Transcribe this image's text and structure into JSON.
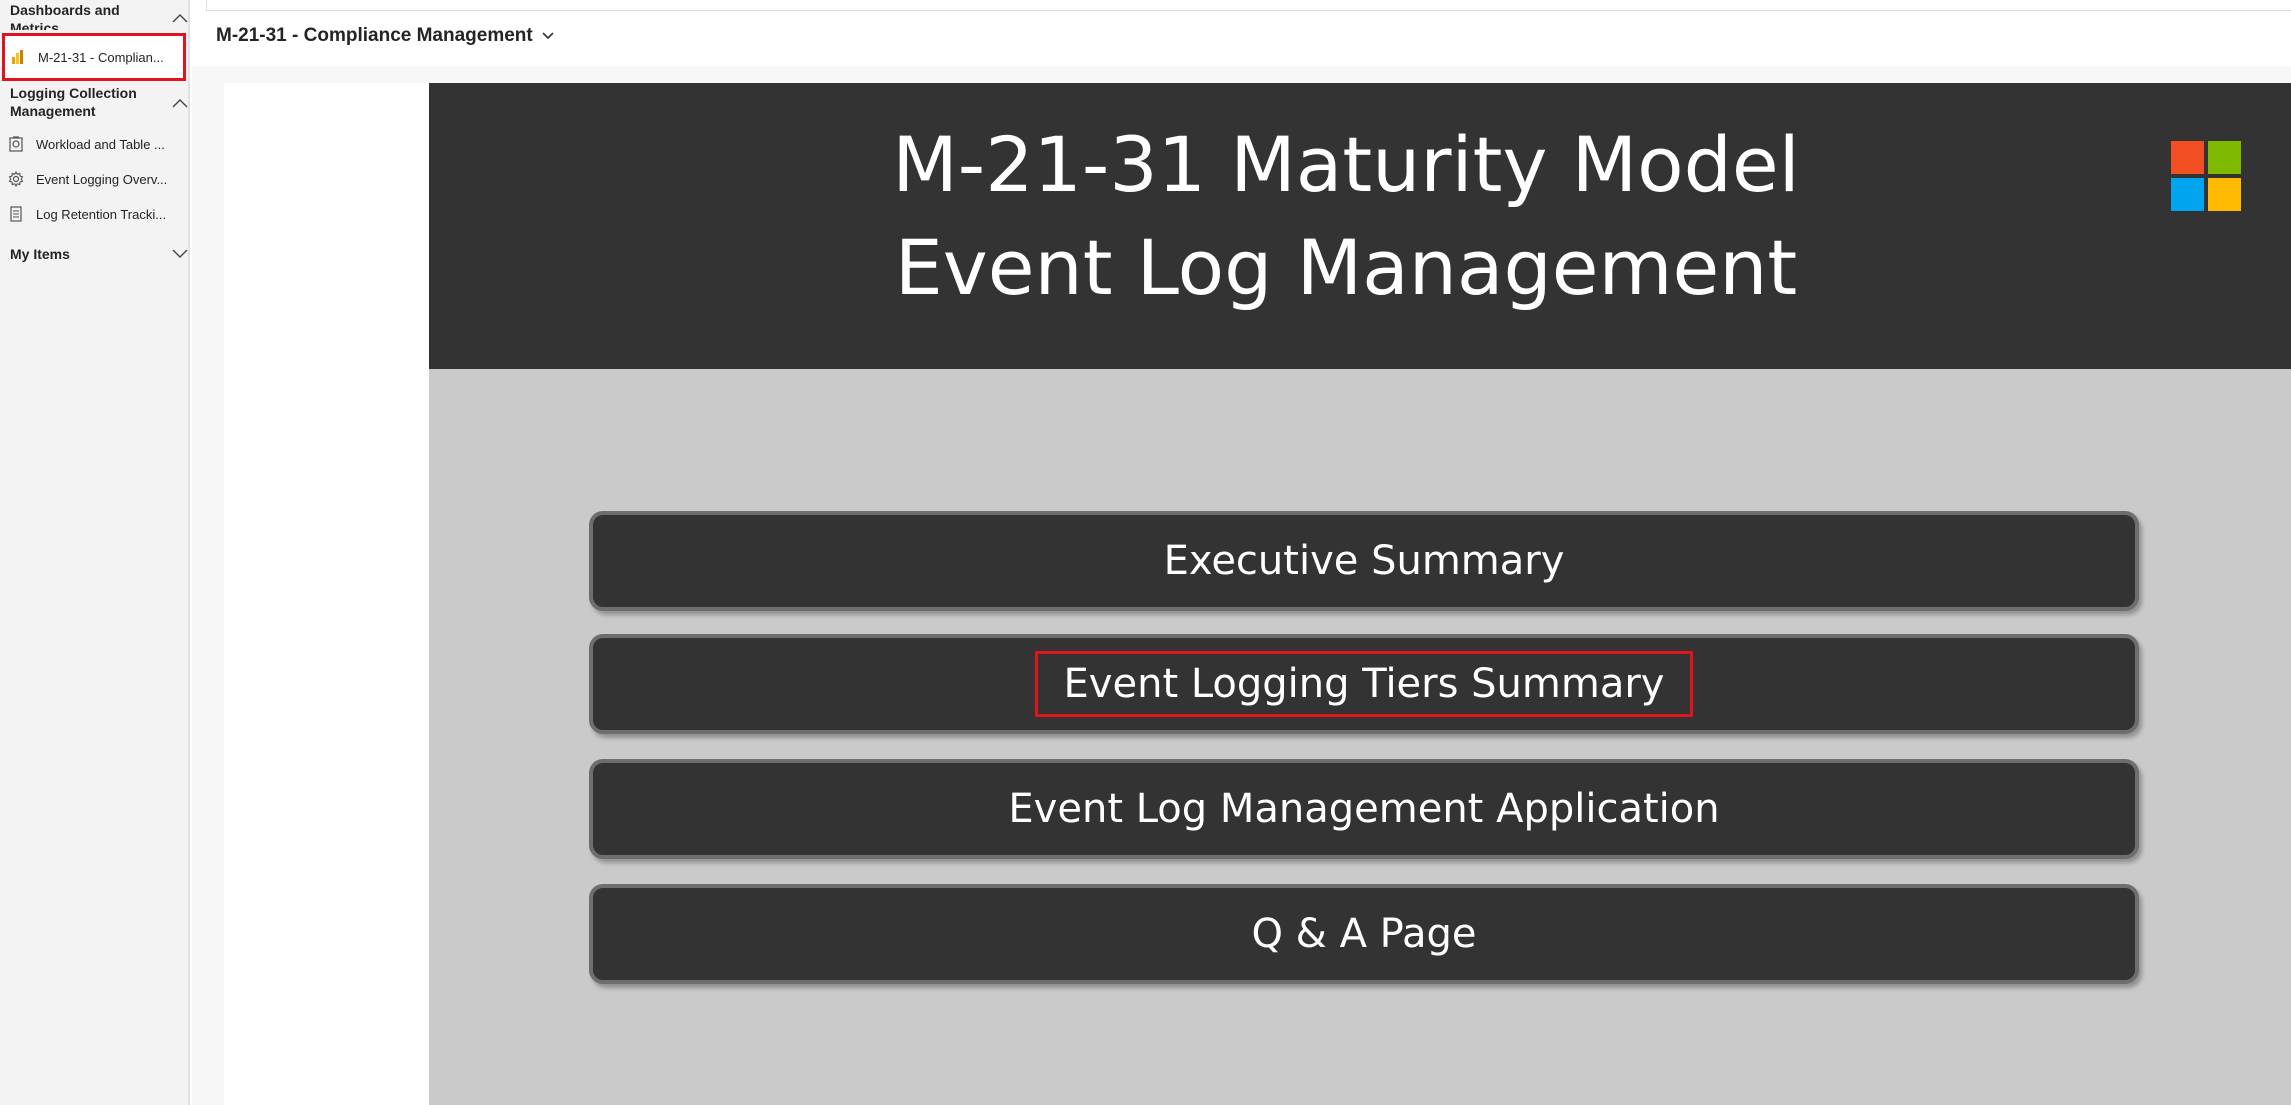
{
  "sidebar": {
    "sections": [
      {
        "title": "Dashboards and Metrics"
      },
      {
        "title": "Logging Collection Management"
      },
      {
        "title": "My Items"
      }
    ],
    "items": [
      {
        "label": "M-21-31 - Complian...",
        "icon": "report-icon"
      },
      {
        "label": "Workload and Table ...",
        "icon": "dataset-icon"
      },
      {
        "label": "Event Logging Overv...",
        "icon": "gear-icon"
      },
      {
        "label": "Log Retention Tracki...",
        "icon": "document-icon"
      }
    ]
  },
  "header": {
    "report_title": "M-21-31 - Compliance Management"
  },
  "report": {
    "title_line1": "M-21-31 Maturity Model",
    "title_line2": "Event Log Management",
    "buttons": [
      {
        "label": "Executive Summary"
      },
      {
        "label": "Event Logging Tiers Summary"
      },
      {
        "label": "Event Log Management Application"
      },
      {
        "label": "Q & A Page"
      }
    ],
    "logo": {
      "name": "microsoft-logo-icon",
      "colors": [
        "#f25022",
        "#7fba00",
        "#00a4ef",
        "#ffb900"
      ]
    }
  },
  "colors": {
    "highlight": "#e0141e",
    "banner": "#333333",
    "panel": "#cacaca"
  }
}
